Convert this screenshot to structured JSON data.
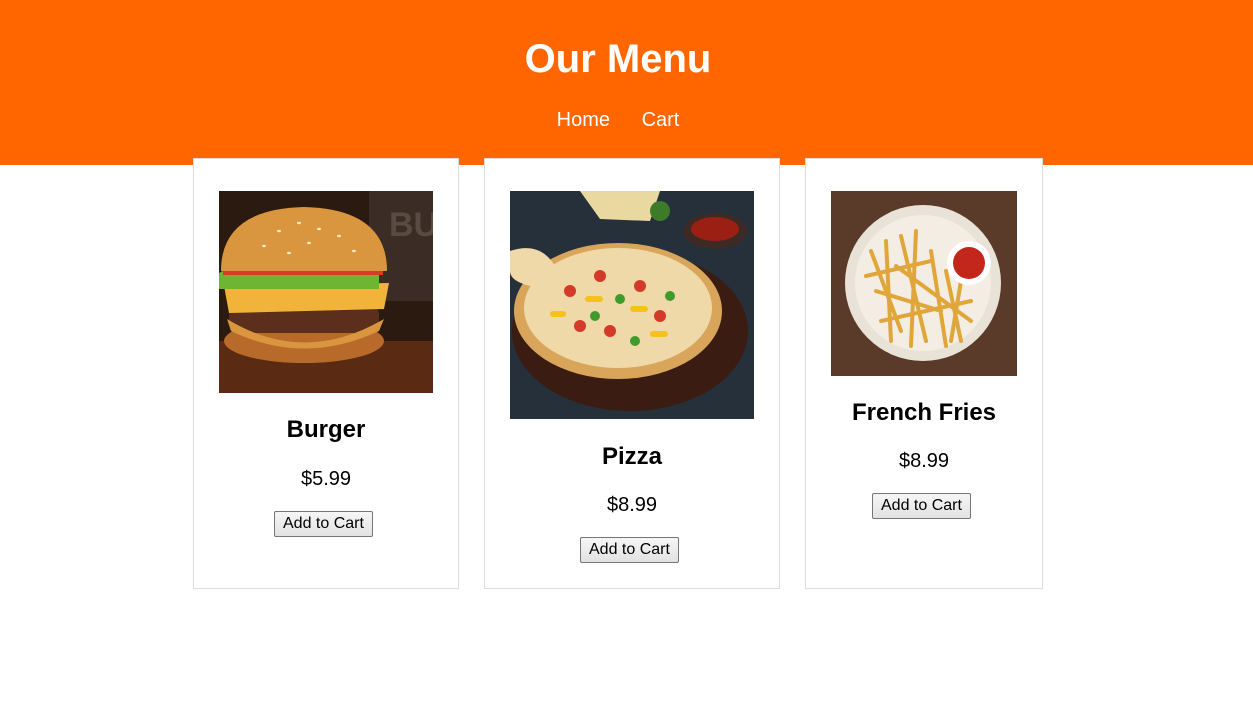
{
  "header": {
    "title": "Our Menu",
    "nav": [
      {
        "label": "Home"
      },
      {
        "label": "Cart"
      }
    ],
    "background_color": "#ff6600"
  },
  "menu": {
    "items": [
      {
        "name": "Burger",
        "price": "$5.99",
        "button_label": "Add to Cart",
        "image": "burger-photo"
      },
      {
        "name": "Pizza",
        "price": "$8.99",
        "button_label": "Add to Cart",
        "image": "pizza-photo"
      },
      {
        "name": "French Fries",
        "price": "$8.99",
        "button_label": "Add to Cart",
        "image": "french-fries-photo"
      }
    ]
  }
}
